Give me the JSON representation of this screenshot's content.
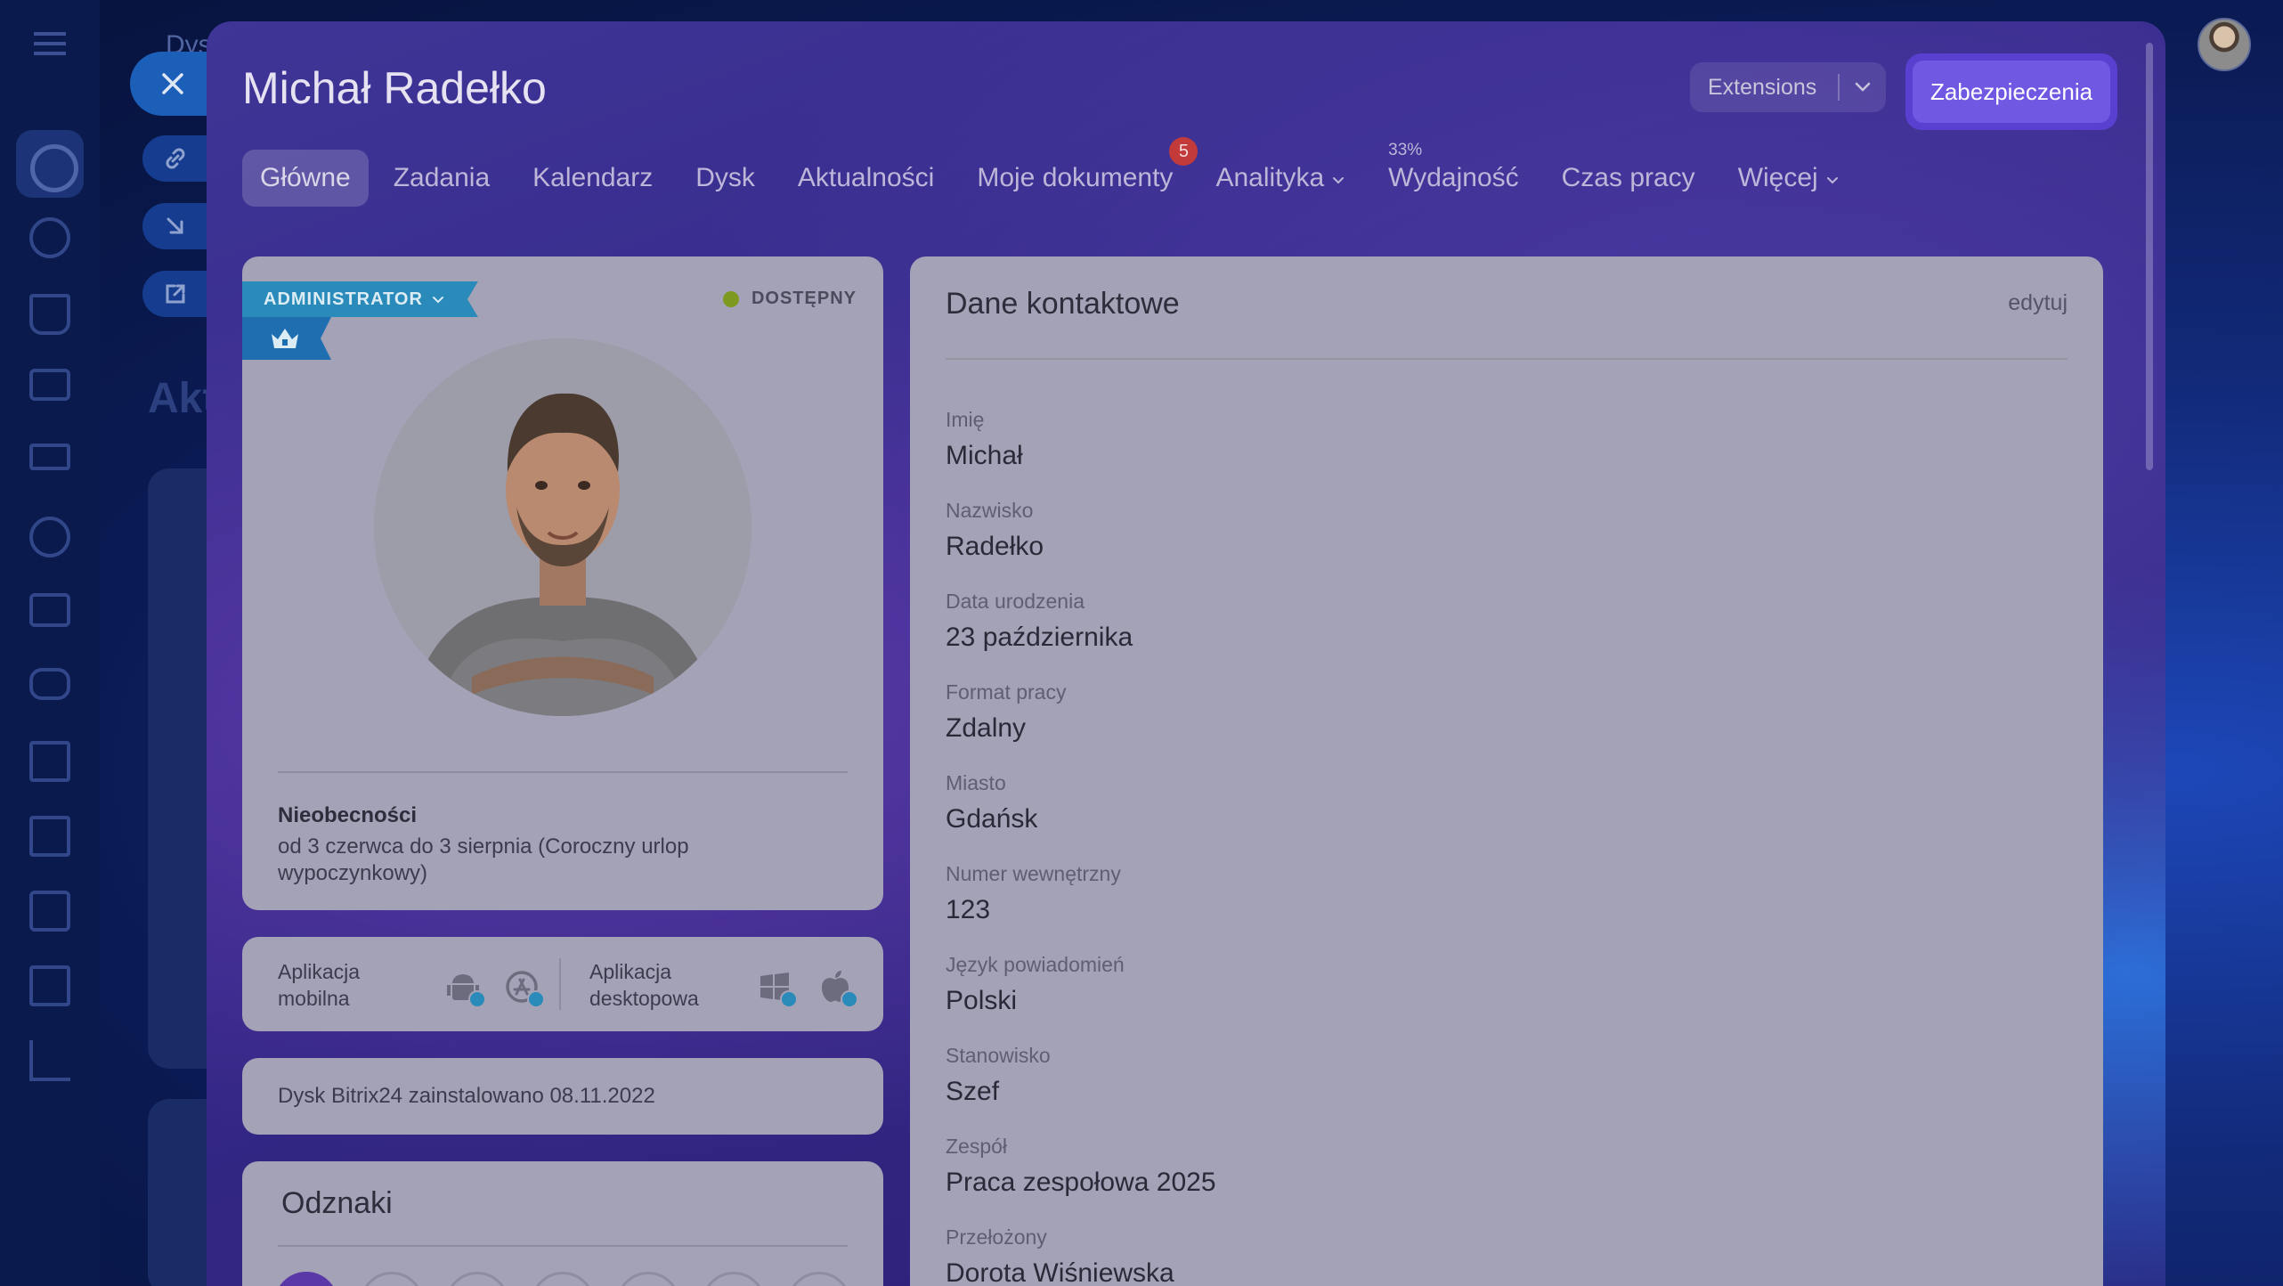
{
  "background": {
    "breadcrumb": "Dys",
    "heading": "Akt"
  },
  "header": {
    "user_name": "Michał Radełko",
    "extensions_label": "Extensions",
    "security_label": "Zabezpieczenia"
  },
  "tabs": [
    {
      "label": "Główne",
      "active": true
    },
    {
      "label": "Zadania"
    },
    {
      "label": "Kalendarz"
    },
    {
      "label": "Dysk"
    },
    {
      "label": "Aktualności"
    },
    {
      "label": "Moje dokumenty",
      "badge": "5"
    },
    {
      "label": "Analityka",
      "dropdown": true
    },
    {
      "label": "Wydajność",
      "percent": "33%"
    },
    {
      "label": "Czas pracy"
    },
    {
      "label": "Więcej",
      "dropdown": true
    }
  ],
  "profile": {
    "role": "ADMINISTRATOR",
    "status": "DOSTĘPNY",
    "status_color": "#7e9a1e",
    "absence_title": "Nieobecności",
    "absence_text": "od 3 czerwca do 3 sierpnia (Coroczny urlop wypoczynkowy)"
  },
  "apps": {
    "mobile_label": "Aplikacja mobilna",
    "desktop_label": "Aplikacja desktopowa"
  },
  "disk": {
    "text": "Dysk Bitrix24 zainstalowano 08.11.2022"
  },
  "badges": {
    "title": "Odznaki"
  },
  "contact": {
    "title": "Dane kontaktowe",
    "edit_label": "edytuj",
    "fields": [
      {
        "label": "Imię",
        "value": "Michał"
      },
      {
        "label": "Nazwisko",
        "value": "Radełko"
      },
      {
        "label": "Data urodzenia",
        "value": "23 października"
      },
      {
        "label": "Format pracy",
        "value": "Zdalny"
      },
      {
        "label": "Miasto",
        "value": "Gdańsk"
      },
      {
        "label": "Numer wewnętrzny",
        "value": "123"
      },
      {
        "label": "Język powiadomień",
        "value": "Polski"
      },
      {
        "label": "Stanowisko",
        "value": "Szef"
      },
      {
        "label": "Zespół",
        "value": "Praca zespołowa 2025"
      },
      {
        "label": "Przełożony",
        "value": "Dorota Wiśniewska"
      }
    ]
  },
  "colors": {
    "accent_ribbon": "#2a8bbb",
    "security_button": "#7058e3",
    "tab_badge": "#c23a3a"
  }
}
